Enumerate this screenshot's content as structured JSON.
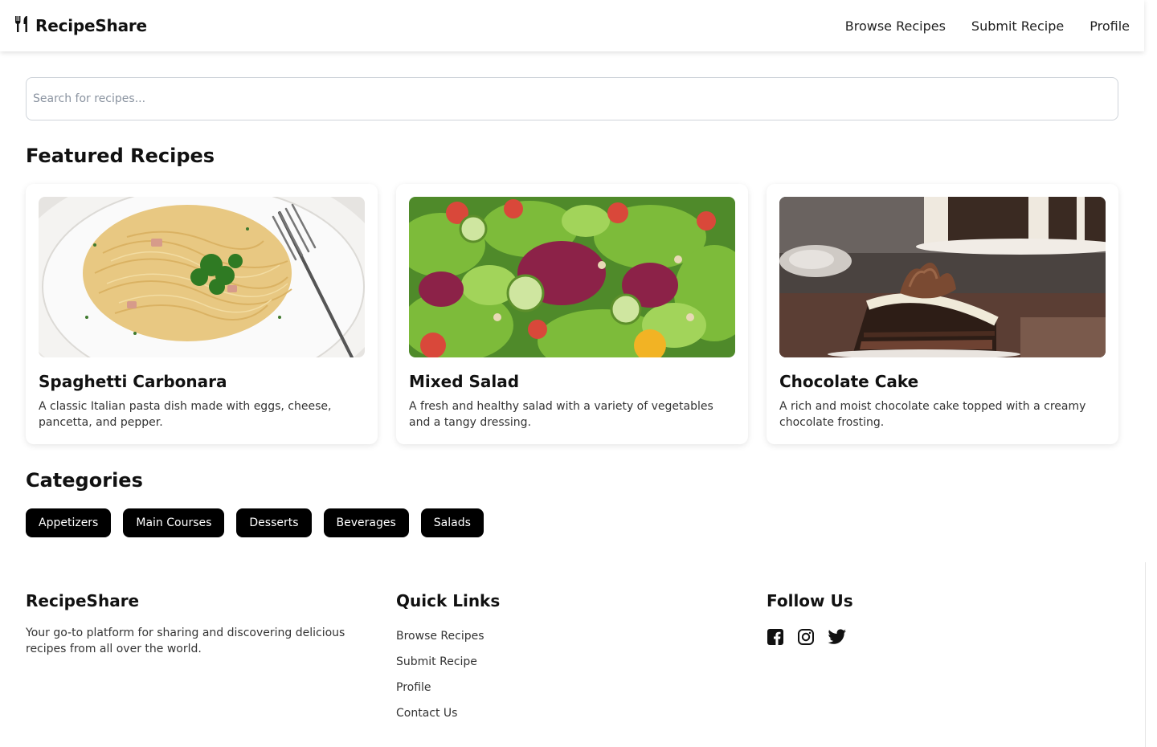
{
  "header": {
    "brand": "RecipeShare",
    "nav": [
      "Browse Recipes",
      "Submit Recipe",
      "Profile"
    ]
  },
  "search": {
    "placeholder": "Search for recipes..."
  },
  "featured": {
    "title": "Featured Recipes",
    "cards": [
      {
        "title": "Spaghetti Carbonara",
        "description": "A classic Italian pasta dish made with eggs, cheese, pancetta, and pepper."
      },
      {
        "title": "Mixed Salad",
        "description": "A fresh and healthy salad with a variety of vegetables and a tangy dressing."
      },
      {
        "title": "Chocolate Cake",
        "description": "A rich and moist chocolate cake topped with a creamy chocolate frosting."
      }
    ]
  },
  "categories": {
    "title": "Categories",
    "items": [
      "Appetizers",
      "Main Courses",
      "Desserts",
      "Beverages",
      "Salads"
    ]
  },
  "footer": {
    "about": {
      "heading": "RecipeShare",
      "text": "Your go-to platform for sharing and discovering delicious recipes from all over the world."
    },
    "quick_links": {
      "heading": "Quick Links",
      "links": [
        "Browse Recipes",
        "Submit Recipe",
        "Profile",
        "Contact Us"
      ]
    },
    "follow": {
      "heading": "Follow Us",
      "icons": [
        "facebook-icon",
        "instagram-icon",
        "twitter-icon"
      ]
    }
  },
  "colors": {
    "accent": "#000000",
    "text": "#111111",
    "muted": "#333333",
    "border": "#cfd4da"
  }
}
